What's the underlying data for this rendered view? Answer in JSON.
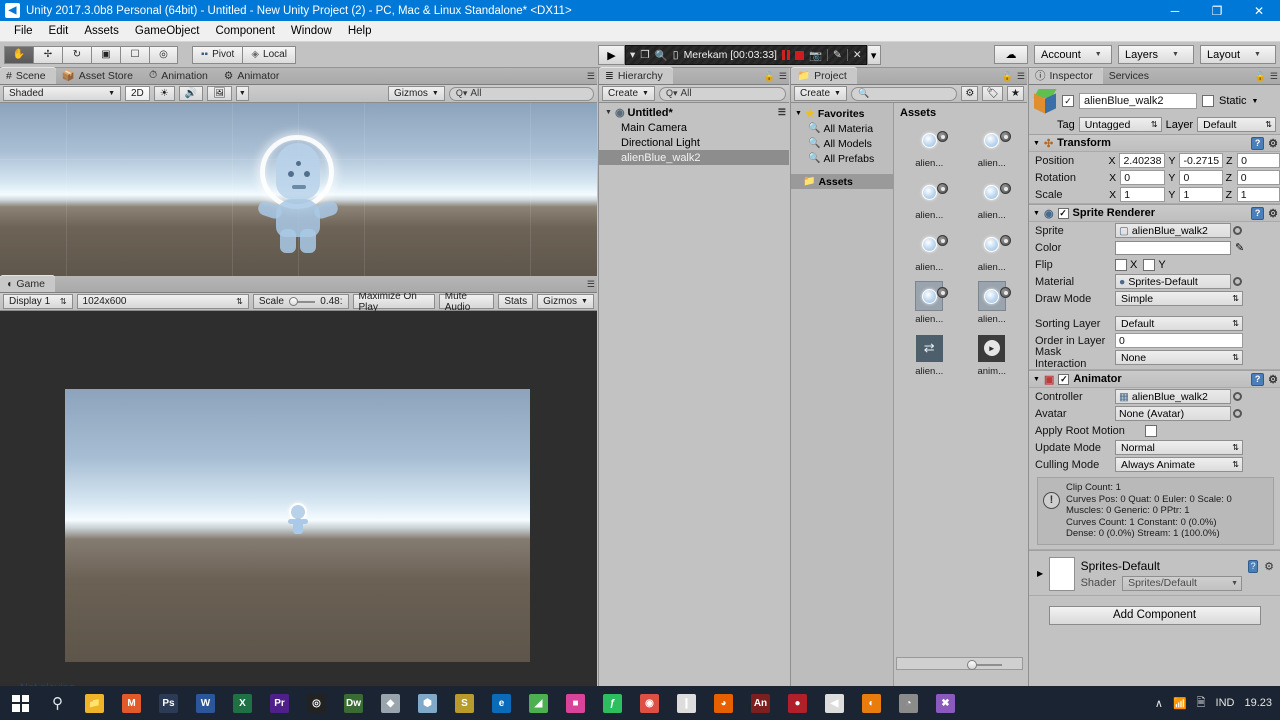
{
  "window": {
    "title": "Unity 2017.3.0b8 Personal (64bit) - Untitled - New Unity Project (2) - PC, Mac & Linux Standalone* <DX11>",
    "minimize": "─",
    "maximize": "❐",
    "close": "✕"
  },
  "menu": [
    "File",
    "Edit",
    "Assets",
    "GameObject",
    "Component",
    "Window",
    "Help"
  ],
  "toolbar": {
    "tools": [
      "hand-tool",
      "move-tool",
      "rotate-tool",
      "scale-tool",
      "rect-tool",
      "transform-tool"
    ],
    "pivot_label": "Pivot",
    "local_label": "Local",
    "play_label": "▶",
    "pause_label": "❚❚",
    "step_label": "▶❚",
    "account_label": "Account",
    "layers_label": "Layers",
    "layout_label": "Layout"
  },
  "recorder": {
    "status_text": "Merekam [00:03:33]",
    "pause_icon": "pause-icon",
    "stop_icon": "stop-icon",
    "camera_icon": "camera-icon",
    "pen_icon": "pen-icon",
    "close_icon": "✕",
    "arrow_icon": "▾"
  },
  "scene": {
    "tabs": [
      {
        "label": "Scene",
        "icon": "#",
        "active": true
      },
      {
        "label": "Asset Store",
        "icon": "🛎",
        "active": false
      },
      {
        "label": "Animation",
        "icon": "◴",
        "active": false
      },
      {
        "label": "Animator",
        "icon": "⚙",
        "active": false
      }
    ],
    "shading_mode": "Shaded",
    "mode_2d": "2D",
    "lighting_icon": "sun-icon",
    "audio_icon": "speaker-icon",
    "fx_icon": "image-icon",
    "gizmos_label": "Gizmos",
    "search_value": "All",
    "search_icon": "Q"
  },
  "game": {
    "tab_label": "Game",
    "display": "Display 1",
    "resolution": "1024x600",
    "scale_label": "Scale",
    "scale_value": "0.48:",
    "maximize_label": "Maximize On Play",
    "mute_label": "Mute Audio",
    "stats_label": "Stats",
    "gizmos_label": "Gizmos"
  },
  "hierarchy": {
    "tab_label": "Hierarchy",
    "create_label": "Create",
    "search_value": "All",
    "root": "Untitled*",
    "items": [
      {
        "label": "Main Camera",
        "selected": false
      },
      {
        "label": "Directional Light",
        "selected": false
      },
      {
        "label": "alienBlue_walk2",
        "selected": true
      }
    ]
  },
  "project": {
    "tab_label": "Project",
    "create_label": "Create",
    "search_value": "",
    "favorites_label": "Favorites",
    "favorites": [
      "All Materia",
      "All Models",
      "All Prefabs"
    ],
    "assets_tree_label": "Assets",
    "assets_header": "Assets",
    "assets": [
      {
        "label": "alien...",
        "kind": "sprite"
      },
      {
        "label": "alien...",
        "kind": "sprite"
      },
      {
        "label": "alien...",
        "kind": "sprite"
      },
      {
        "label": "alien...",
        "kind": "sprite"
      },
      {
        "label": "alien...",
        "kind": "sprite"
      },
      {
        "label": "alien...",
        "kind": "sprite"
      },
      {
        "label": "alien...",
        "kind": "texture"
      },
      {
        "label": "alien...",
        "kind": "texture"
      },
      {
        "label": "alien...",
        "kind": "controller"
      },
      {
        "label": "anim...",
        "kind": "clip"
      }
    ]
  },
  "inspector": {
    "tabs": [
      {
        "label": "Inspector",
        "active": true
      },
      {
        "label": "Services",
        "active": false
      }
    ],
    "object_name": "alienBlue_walk2",
    "enabled_check": "✓",
    "static_label": "Static",
    "tag_label": "Tag",
    "tag_value": "Untagged",
    "layer_label": "Layer",
    "layer_value": "Default",
    "transform": {
      "title": "Transform",
      "rows": [
        {
          "label": "Position",
          "x": "2.40238",
          "y": "-0.2715",
          "z": "0"
        },
        {
          "label": "Rotation",
          "x": "0",
          "y": "0",
          "z": "0"
        },
        {
          "label": "Scale",
          "x": "1",
          "y": "1",
          "z": "1"
        }
      ],
      "axis_x": "X",
      "axis_y": "Y",
      "axis_z": "Z"
    },
    "sprite_renderer": {
      "title": "Sprite Renderer",
      "sprite_label": "Sprite",
      "sprite_value": "alienBlue_walk2",
      "color_label": "Color",
      "color_value": "#FFFFFF",
      "flip_label": "Flip",
      "flip_x": "X",
      "flip_y": "Y",
      "material_label": "Material",
      "material_value": "Sprites-Default",
      "draw_mode_label": "Draw Mode",
      "draw_mode_value": "Simple",
      "sorting_layer_label": "Sorting Layer",
      "sorting_layer_value": "Default",
      "order_label": "Order in Layer",
      "order_value": "0",
      "mask_label": "Mask Interaction",
      "mask_value": "None"
    },
    "animator": {
      "title": "Animator",
      "controller_label": "Controller",
      "controller_value": "alienBlue_walk2",
      "avatar_label": "Avatar",
      "avatar_value": "None (Avatar)",
      "root_motion_label": "Apply Root Motion",
      "update_mode_label": "Update Mode",
      "update_mode_value": "Normal",
      "culling_mode_label": "Culling Mode",
      "culling_mode_value": "Always Animate",
      "info_lines": [
        "Clip Count: 1",
        "Curves Pos: 0 Quat: 0 Euler: 0 Scale: 0",
        "Muscles: 0 Generic: 0 PPtr: 1",
        "Curves Count: 1 Constant: 0 (0.0%)",
        "Dense: 0 (0.0%) Stream: 1 (100.0%)"
      ],
      "warn_icon": "!"
    },
    "material": {
      "name": "Sprites-Default",
      "shader_label": "Shader",
      "shader_value": "Sprites/Default"
    },
    "add_component_label": "Add Component"
  },
  "status": {
    "not_playing": "Not playing"
  },
  "taskbar": {
    "start_icon": "windows-icon",
    "search_icon": "search-icon",
    "apps": [
      {
        "name": "file-explorer",
        "glyph": "📁",
        "color": "#f0b429"
      },
      {
        "name": "mendeley",
        "glyph": "M",
        "color": "#e05a2b"
      },
      {
        "name": "photoshop",
        "glyph": "Ps",
        "color": "#2b3a55"
      },
      {
        "name": "word",
        "glyph": "W",
        "color": "#2b579a"
      },
      {
        "name": "excel",
        "glyph": "X",
        "color": "#1e7145"
      },
      {
        "name": "premiere",
        "glyph": "Pr",
        "color": "#50208a"
      },
      {
        "name": "recorder",
        "glyph": "◎",
        "color": "#222222"
      },
      {
        "name": "dreamweaver",
        "glyph": "Dw",
        "color": "#3a6b35"
      },
      {
        "name": "unity-hub",
        "glyph": "◆",
        "color": "#9aa4ad"
      },
      {
        "name": "unity",
        "glyph": "⬢",
        "color": "#7fa8c9"
      },
      {
        "name": "sublime",
        "glyph": "S",
        "color": "#b89b2a"
      },
      {
        "name": "edge",
        "glyph": "e",
        "color": "#0b6bb8"
      },
      {
        "name": "green-app",
        "glyph": "◢",
        "color": "#4caf50"
      },
      {
        "name": "color-app",
        "glyph": "■",
        "color": "#d9439a"
      },
      {
        "name": "evernote",
        "glyph": "ƒ",
        "color": "#2dbe60"
      },
      {
        "name": "chrome",
        "glyph": "◉",
        "color": "#dd5144"
      },
      {
        "name": "adobe-reader",
        "glyph": "❙",
        "color": "#dddddd"
      },
      {
        "name": "firefox",
        "glyph": "◕",
        "color": "#e66000"
      },
      {
        "name": "animate",
        "glyph": "An",
        "color": "#7b1f1f"
      },
      {
        "name": "record-red",
        "glyph": "●",
        "color": "#b0202b"
      },
      {
        "name": "unity-active",
        "glyph": "◀",
        "color": "#dddddd"
      },
      {
        "name": "blender",
        "glyph": "◐",
        "color": "#e87d0d"
      },
      {
        "name": "gimp",
        "glyph": "◔",
        "color": "#8b8b8b"
      },
      {
        "name": "visual-studio",
        "glyph": "✖",
        "color": "#8a5bbd"
      }
    ],
    "tray_chevron": "∧",
    "tray_icons": [
      "network-icon",
      "notification-icon"
    ],
    "language": "IND",
    "clock": "19.23"
  }
}
